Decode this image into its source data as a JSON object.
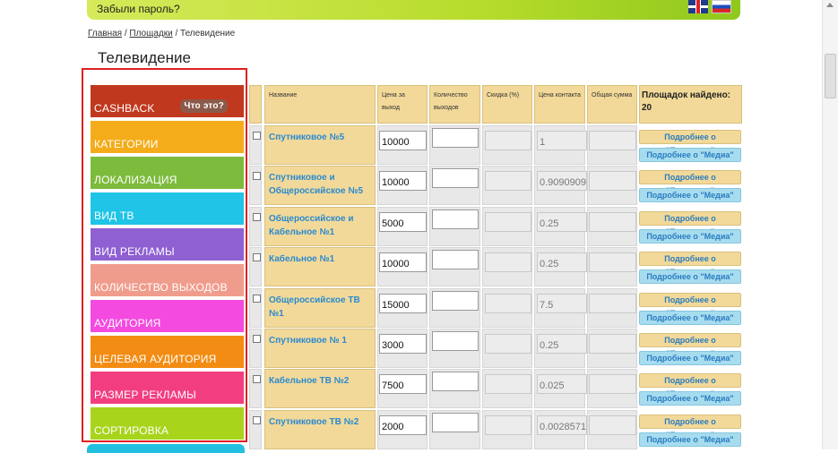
{
  "header": {
    "forgot_password": "Забыли пароль?"
  },
  "breadcrumb": {
    "home": "Главная",
    "sep1": " / ",
    "venues": "Площадки",
    "sep2": " / ",
    "current": "Телевидение"
  },
  "page_title": "Телевидение",
  "filters": {
    "cashback_help": "Что это?",
    "items": [
      {
        "label": "CASHBACK",
        "color": "#c0391f"
      },
      {
        "label": "КАТЕГОРИИ",
        "color": "#f4ac1a"
      },
      {
        "label": "ЛОКАЛИЗАЦИЯ",
        "color": "#7cbb3c"
      },
      {
        "label": "ВИД ТВ",
        "color": "#1fc4e6"
      },
      {
        "label": "ВИД РЕКЛАМЫ",
        "color": "#8e60d2"
      },
      {
        "label": "КОЛИЧЕСТВО ВЫХОДОВ",
        "color": "#f09c8c"
      },
      {
        "label": "АУДИТОРИЯ",
        "color": "#f44ae0"
      },
      {
        "label": "ЦЕЛЕВАЯ АУДИТОРИЯ",
        "color": "#f38c12"
      },
      {
        "label": "РАЗМЕР РЕКЛАМЫ",
        "color": "#f23e80"
      },
      {
        "label": "СОРТИРОВКА",
        "color": "#a8d41c"
      }
    ]
  },
  "table": {
    "headers": {
      "name": "Название",
      "price": "Цена за выход",
      "quantity": "Количество выходов",
      "discount": "Скидка (%)",
      "contact_price": "Цена контакта",
      "total": "Общая сумма",
      "found": "Площадок найдено: 20"
    },
    "rows": [
      {
        "name": "Спутниковое №5",
        "price": "10000",
        "contact": "1"
      },
      {
        "name": "Спутниковое и Общероссийское №5",
        "price": "10000",
        "contact": "0.9090909"
      },
      {
        "name": "Общероссийское и Кабельное №1",
        "price": "5000",
        "contact": "0.25"
      },
      {
        "name": "Кабельное №1",
        "price": "10000",
        "contact": "0.25"
      },
      {
        "name": "Общероссийское ТВ №1",
        "price": "15000",
        "contact": "7.5"
      },
      {
        "name": "Спутниковое № 1",
        "price": "3000",
        "contact": "0.25"
      },
      {
        "name": "Кабельное ТВ №2",
        "price": "7500",
        "contact": "0.025"
      },
      {
        "name": "Спутниковое ТВ №2",
        "price": "2000",
        "contact": "0.0028571"
      }
    ],
    "button_venue": "Подробнее о \"Площадке\"",
    "button_media": "Подробнее о \"Медиа\""
  }
}
